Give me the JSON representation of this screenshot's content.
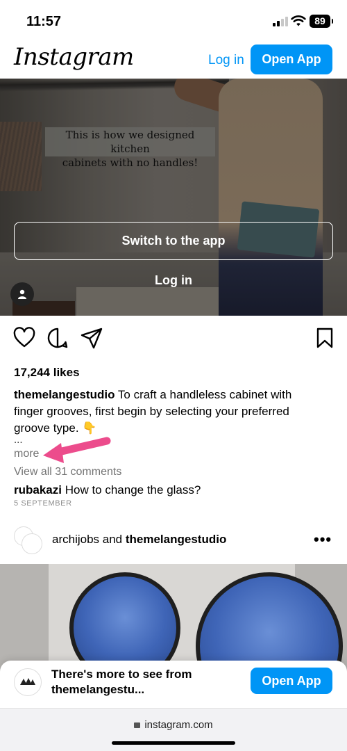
{
  "status_bar": {
    "time": "11:57",
    "battery": "89"
  },
  "header": {
    "logo": "Instagram",
    "login_label": "Log in",
    "open_app_label": "Open App"
  },
  "media": {
    "caption_line1": "This is how we designed kitchen",
    "caption_line2": "cabinets with no handles!",
    "switch_label": "Switch to the app",
    "login_label": "Log in"
  },
  "post": {
    "likes": "17,244 likes",
    "username": "themelangestudio",
    "caption": " To craft a handleless cabinet with finger grooves, first begin by selecting your preferred groove type. 👇",
    "ellipsis": "...",
    "more": "more",
    "view_comments": "View all 31 comments",
    "comment_user": "rubakazi",
    "comment_text": " How to change the glass?",
    "date": "5 SEPTEMBER"
  },
  "next_post": {
    "user1": "archijobs",
    "and": " and ",
    "user2": "themelangestudio",
    "more": "•••"
  },
  "banner": {
    "text": "There's more to see from themelangestu...",
    "button": "Open App"
  },
  "browser": {
    "url": "instagram.com"
  },
  "colors": {
    "accent": "#0095f6",
    "annotation_arrow": "#ec4c8c"
  }
}
